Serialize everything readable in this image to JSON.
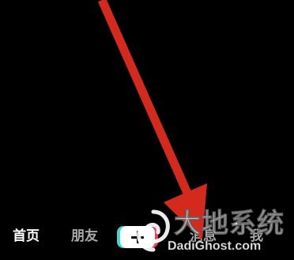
{
  "tab_bar": {
    "home_label": "首页",
    "friends_label": "朋友",
    "add_icon": "plus-icon",
    "messages_label": "消息",
    "me_label": "我"
  },
  "overlay": {
    "arrow_color": "#d42a1e",
    "arrow_icon": "arrow-pointing-icon"
  },
  "watermark": {
    "logo_icon": "spiral-logo-icon",
    "title": "大地系统",
    "url": "DadiGhost.com"
  },
  "colors": {
    "background": "#000000",
    "active_tab": "#ffffff",
    "inactive_tab": "#a8a8a8",
    "add_button_left_accent": "#3bd8d6",
    "add_button_right_accent": "#e9435a"
  }
}
